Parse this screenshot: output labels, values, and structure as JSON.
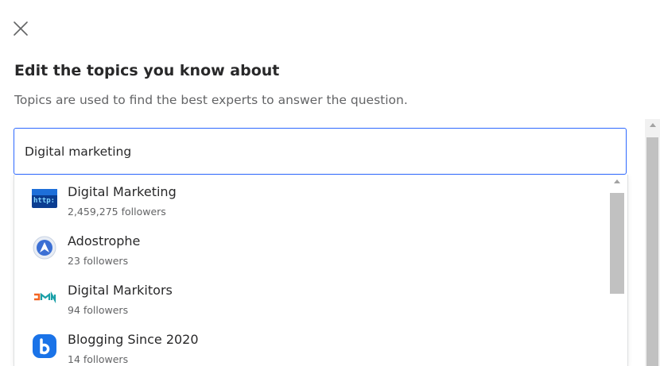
{
  "modal": {
    "title": "Edit the topics you know about",
    "subtitle": "Topics are used to find the best experts to answer the question."
  },
  "search": {
    "value": "Digital marketing",
    "accent_color": "#2e69ff"
  },
  "results": [
    {
      "name": "Digital Marketing",
      "followers": "2,459,275 followers",
      "icon": "digital-marketing-topic-icon"
    },
    {
      "name": "Adostrophe",
      "followers": "23 followers",
      "icon": "adostrophe-logo-icon"
    },
    {
      "name": "Digital Markitors",
      "followers": "94 followers",
      "icon": "digital-markitors-logo-icon"
    },
    {
      "name": "Blogging Since 2020",
      "followers": "14 followers",
      "icon": "blogging-logo-icon"
    }
  ]
}
